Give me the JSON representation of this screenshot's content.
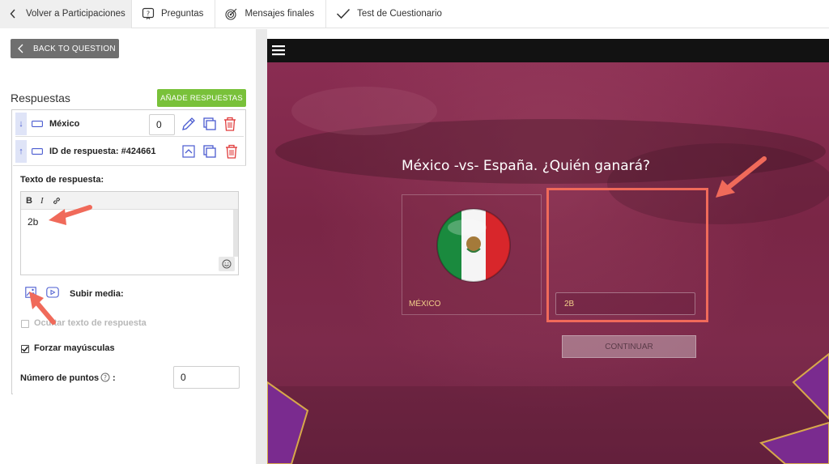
{
  "nav": {
    "back_label": "Volver a Participaciones",
    "tabs": [
      {
        "label": "Preguntas",
        "icon": "question-bubble-icon"
      },
      {
        "label": "Mensajes finales",
        "icon": "target-icon"
      },
      {
        "label": "Test de Cuestionario",
        "icon": "check-icon"
      }
    ]
  },
  "editor_panel": {
    "back_button": "BACK TO QUESTION",
    "answers_title": "Respuestas",
    "add_button": "AÑADE RESPUESTAS",
    "answers": [
      {
        "label": "México",
        "points": "0",
        "arrow": "↓"
      },
      {
        "label": "ID de respuesta: #424661",
        "arrow": "↑"
      }
    ],
    "answer_text_label": "Texto de respuesta:",
    "toolbar": {
      "bold": "B",
      "italic": "I"
    },
    "answer_text_value": "2b",
    "upload_media_label": "Subir media:",
    "hide_text_label": "Ocultar texto de respuesta",
    "hide_text_checked": false,
    "force_upper_label": "Forzar mayúsculas",
    "force_upper_checked": true,
    "points_label": "Número de puntos",
    "points_colon": ":",
    "points_value": "0"
  },
  "preview": {
    "question": "México -vs- España. ¿Quién ganará?",
    "option1_label": "MÉXICO",
    "option2_value": "2B",
    "continue_button": "CONTINUAR"
  },
  "colors": {
    "accent_green": "#79c13a",
    "preview_bg": "#7b2a4c",
    "highlight_red": "#f06a5a",
    "gold_text": "#f3d08a"
  }
}
